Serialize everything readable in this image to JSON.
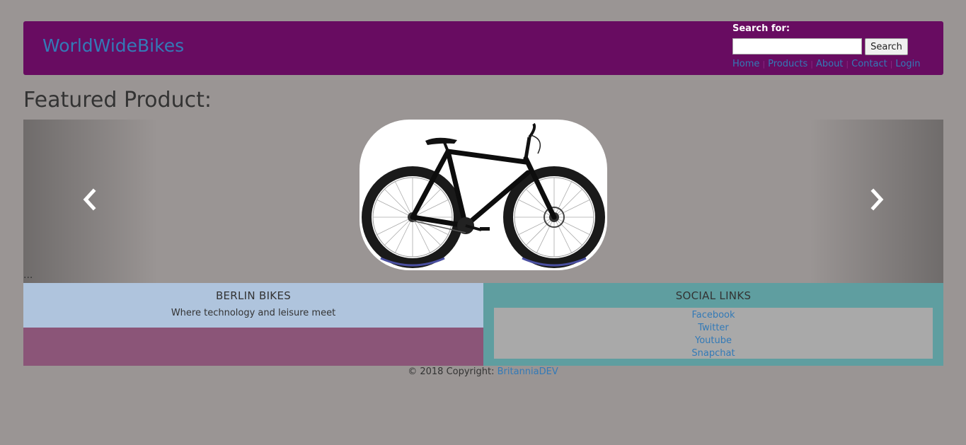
{
  "header": {
    "brand": "WorldWideBikes",
    "search_label": "Search for:",
    "search_value": "",
    "search_button": "Search",
    "nav": [
      "Home",
      "Products",
      "About",
      "Contact",
      "Login"
    ]
  },
  "featured": {
    "title": "Featured Product:",
    "ellipsis": "...",
    "prev_icon": "chevron-left-icon",
    "next_icon": "chevron-right-icon",
    "slide_image": "fat-tire-bicycle"
  },
  "footer": {
    "left_title": "BERLIN BIKES",
    "tagline": "Where technology and leisure meet",
    "right_title": "SOCIAL LINKS",
    "social_links": [
      "Facebook",
      "Twitter",
      "Youtube",
      "Snapchat"
    ],
    "copyright_prefix": "© 2018 Copyright: ",
    "copyright_link": "BritanniaDEV"
  },
  "colors": {
    "page_bg": "#9a9594",
    "header_bg": "#680c61",
    "link": "#337ab7",
    "footer_left_top": "#afc4dd",
    "footer_left_bottom": "#8b5578",
    "footer_right": "#5f9ea0",
    "social_box": "#a9a9a9"
  }
}
